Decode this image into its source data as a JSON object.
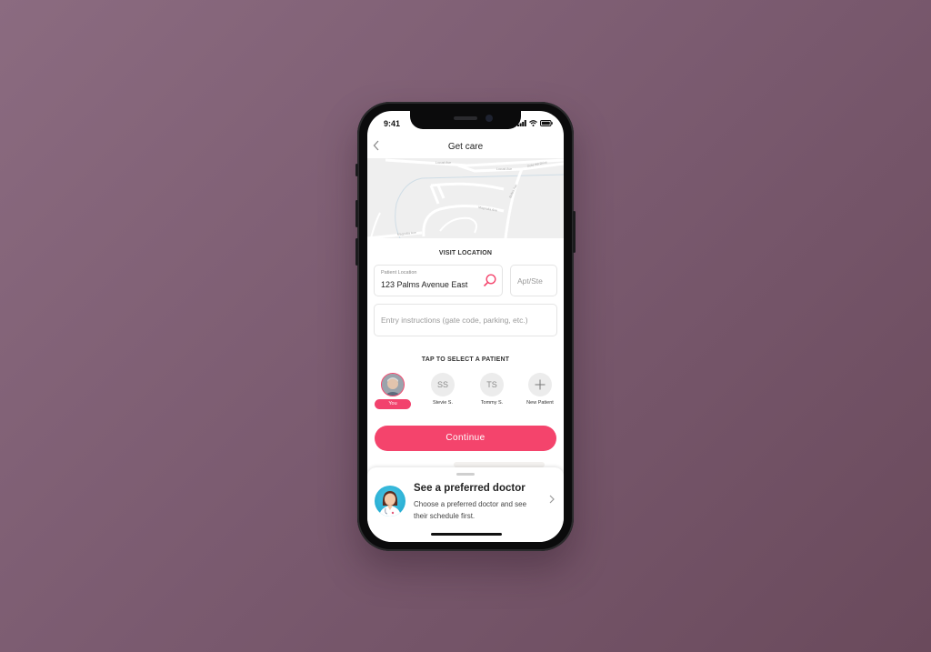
{
  "status_bar": {
    "time": "9:41"
  },
  "nav": {
    "back_label": "‹",
    "title": "Get care"
  },
  "map": {
    "streets": [
      "Locust Ave",
      "Locust Ave",
      "Gold Hill Drive",
      "Bolles Ave",
      "Magnolia Ave",
      "Magnolia Ave"
    ]
  },
  "visit_location": {
    "heading": "VISIT LOCATION",
    "patient_location": {
      "label": "Patient Location",
      "value": "123 Palms Avenue East"
    },
    "apt_ste": {
      "placeholder": "Apt/Ste",
      "value": ""
    },
    "entry_instructions": {
      "placeholder": "Entry instructions (gate code, parking, etc.)",
      "value": ""
    }
  },
  "patients": {
    "heading": "TAP TO SELECT A PATIENT",
    "items": [
      {
        "initials": "",
        "label": "You",
        "selected": true
      },
      {
        "initials": "SS",
        "label": "Stevie S.",
        "selected": false
      },
      {
        "initials": "TS",
        "label": "Tommy S.",
        "selected": false
      },
      {
        "initials": "+",
        "label": "New Patient",
        "selected": false
      }
    ]
  },
  "continue_label": "Continue",
  "preferred_doctor": {
    "title": "See a preferred doctor",
    "description": "Choose a preferred doctor and see their schedule first."
  },
  "colors": {
    "accent": "#f4446c",
    "background_top": "#8b6b80",
    "background_bottom": "#6a4a5c"
  }
}
